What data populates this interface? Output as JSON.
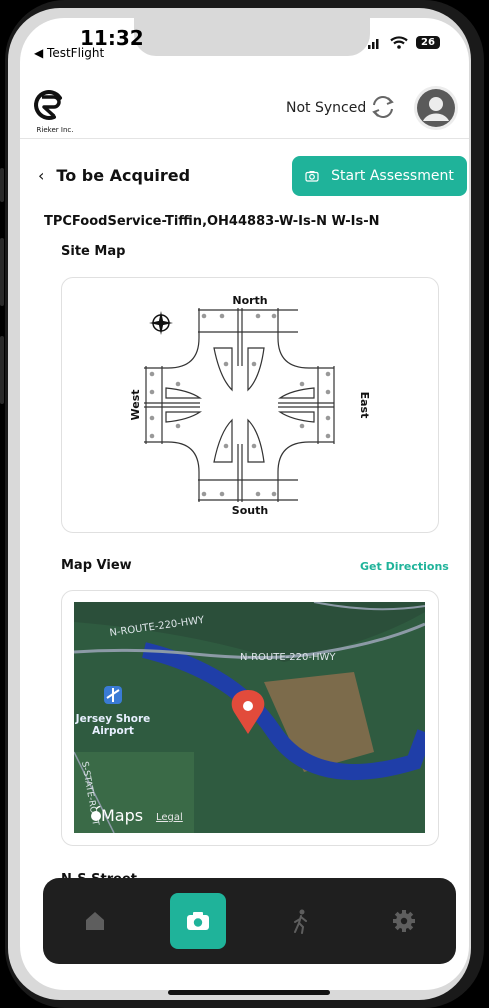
{
  "status_bar": {
    "time": "11:32",
    "back_app": "◀ TestFlight",
    "battery": "26"
  },
  "header": {
    "logo_caption": "Rieker Inc.",
    "sync_status": "Not Synced"
  },
  "page": {
    "back_title": "To be Acquired",
    "start_button": "Start Assessment",
    "site_name": "TPCFoodService-Tiffin,OH44883-W-Is-N W-Is-N",
    "site_map_label": "Site Map",
    "map_view_label": "Map View",
    "get_directions": "Get Directions",
    "next_section_peek": "N-S Street"
  },
  "site_map": {
    "north": "North",
    "south": "South",
    "east": "East",
    "west": "West"
  },
  "map_view": {
    "road_label_1": "N-ROUTE-220-HWY",
    "road_label_2": "N-ROUTE-220-HWY",
    "airport_label_1": "Jersey Shore",
    "airport_label_2": "Airport",
    "street_label": "S-STATE-ROUT",
    "maps_brand": "Maps",
    "legal": "Legal",
    "colors": {
      "land": "#2f5b40",
      "river": "#1f3ea8",
      "pin": "#e24b3b",
      "field": "#8a6e4e"
    }
  },
  "tabs": [
    {
      "name": "home",
      "icon": "home-icon",
      "active": false
    },
    {
      "name": "camera",
      "icon": "camera-icon",
      "active": true
    },
    {
      "name": "walk",
      "icon": "walk-icon",
      "active": false
    },
    {
      "name": "settings",
      "icon": "gear-icon",
      "active": false
    }
  ],
  "colors": {
    "accent": "#1fb39a",
    "tabbar": "#1f1f1f"
  }
}
